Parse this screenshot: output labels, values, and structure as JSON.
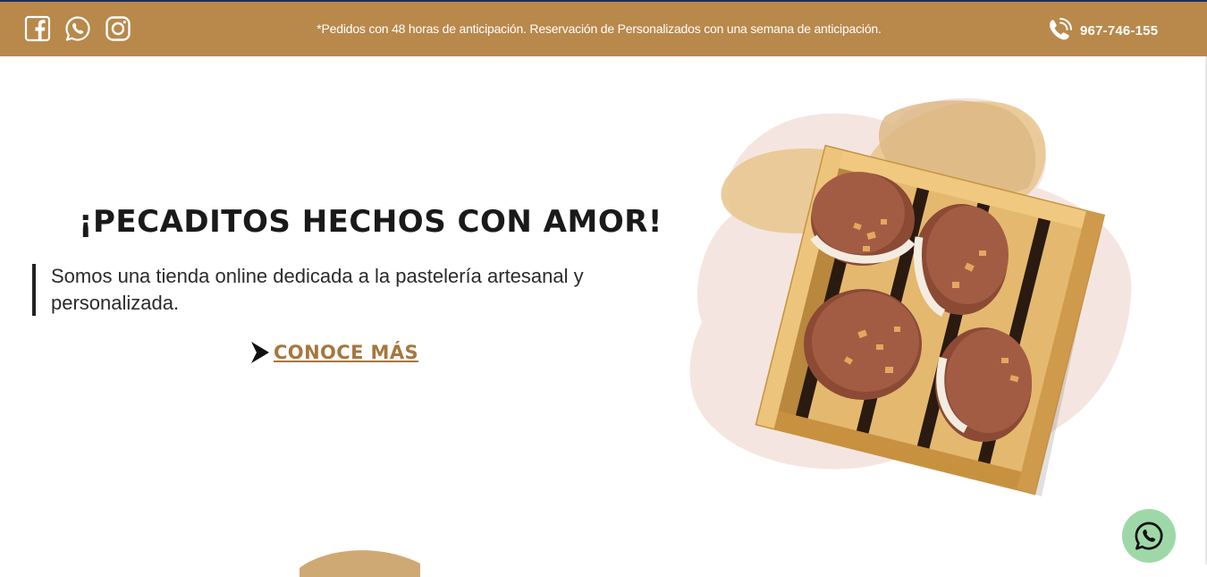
{
  "topbar": {
    "social_icons": [
      "facebook-icon",
      "whatsapp-icon",
      "instagram-icon"
    ],
    "notice": "*Pedidos con 48 horas de anticipación. Reservación de Personalizados con una semana de anticipación.",
    "phone_icon": "phone-icon",
    "phone_number": "967-746-155"
  },
  "hero": {
    "headline": "¡PECADITOS HECHOS CON AMOR!",
    "description": "Somos una tienda online dedicada a la pastelería artesanal y personalizada.",
    "cta_label": "CONOCE MÁS",
    "cta_icon": "arrow-right-icon",
    "image": "cookie-sandwiches-in-wooden-box"
  },
  "floating": {
    "whatsapp_icon": "whatsapp-icon"
  },
  "colors": {
    "topbar_bg": "#b9884b",
    "cta": "#a6773e",
    "whatsapp_fab": "#9fd8a8",
    "headline": "#1a1a1a"
  }
}
